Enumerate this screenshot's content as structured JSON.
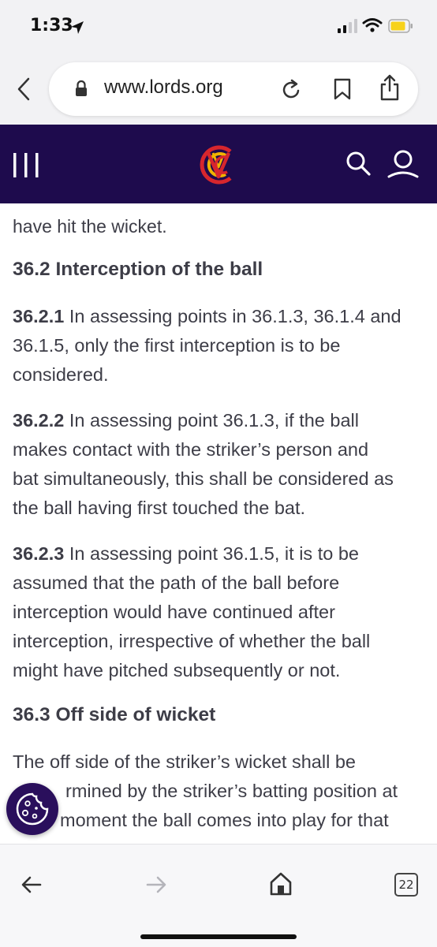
{
  "status_bar": {
    "time": "1:33"
  },
  "browser": {
    "url": "www.lords.org",
    "tab_count": "22"
  },
  "article": {
    "fragment": "have hit the wicket.",
    "section_36_2_heading": "36.2 Interception of the ball",
    "p1_num": "36.2.1",
    "p1_line1": " In assessing points in 36.1.3, 36.1.4 and",
    "p1_line2": "36.1.5, only the first interception is to be",
    "p1_line3": "considered.",
    "p2_num": "36.2.2",
    "p2_line1": " In assessing point 36.1.3, if the ball",
    "p2_line2": "makes contact with the striker’s person and",
    "p2_line3": "bat simultaneously, this shall be considered as",
    "p2_line4": "the ball having first touched the bat.",
    "p3_num": "36.2.3",
    "p3_line1": " In assessing point 36.1.5, it is to be",
    "p3_line2": "assumed that the path of the ball before",
    "p3_line3": "interception would have continued after",
    "p3_line4": "interception, irrespective of whether the ball",
    "p3_line5": "might have pitched subsequently or not.",
    "section_36_3_heading": "36.3 Off side of wicket",
    "p4_line1": "The off side of the striker’s wicket shall be",
    "p4_line2": "rmined by the striker’s batting position at",
    "p4_line3": "moment the ball comes into play for that"
  },
  "icons": {
    "location": "location-arrow-icon",
    "signal": "signal-icon",
    "wifi": "wifi-icon",
    "battery": "battery-icon",
    "back": "chevron-left-icon",
    "lock": "lock-icon",
    "reload": "reload-icon",
    "bookmark": "bookmark-icon",
    "share": "share-icon",
    "menu": "menu-icon",
    "logo": "mcc-logo",
    "search": "search-icon",
    "account": "account-icon",
    "cookie": "cookie-icon",
    "home": "home-icon"
  },
  "colors": {
    "header_bg": "#1e0b4d",
    "logo_red": "#d7262d",
    "logo_gold": "#f0b400",
    "text": "#3d3d47",
    "battery": "#f7d21a"
  }
}
